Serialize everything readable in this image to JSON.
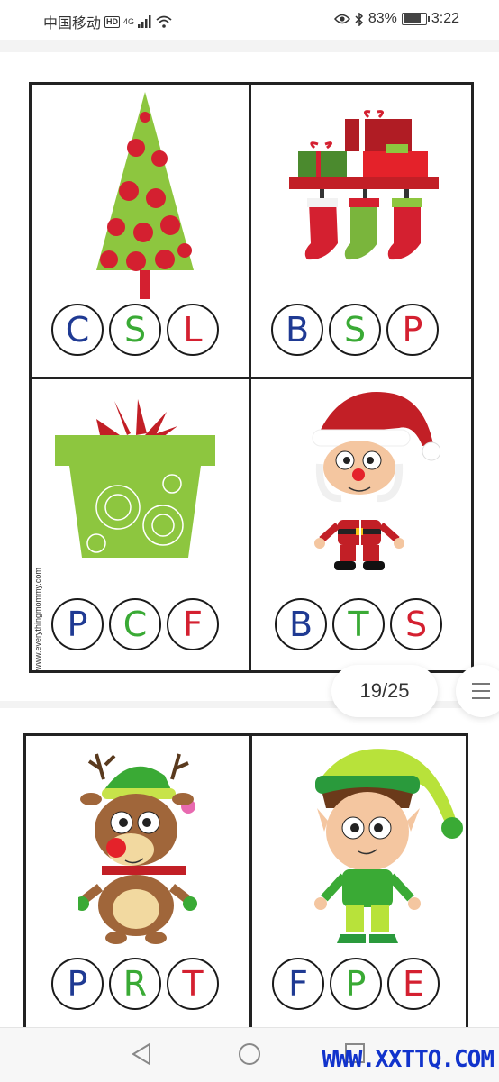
{
  "status_bar": {
    "carrier": "中国移动",
    "hd_badge": "HD",
    "network": "4G",
    "battery_percent": "83%",
    "battery_level": 0.83,
    "time": "3:22"
  },
  "pages": [
    {
      "cards": [
        {
          "picture": "christmas-tree-icon",
          "letters": [
            {
              "char": "C",
              "color": "#1f3a93"
            },
            {
              "char": "S",
              "color": "#3aaa35"
            },
            {
              "char": "L",
              "color": "#d42030"
            }
          ]
        },
        {
          "picture": "stockings-and-gifts-icon",
          "letters": [
            {
              "char": "B",
              "color": "#1f3a93"
            },
            {
              "char": "S",
              "color": "#3aaa35"
            },
            {
              "char": "P",
              "color": "#d42030"
            }
          ]
        },
        {
          "picture": "gift-box-icon",
          "letters": [
            {
              "char": "P",
              "color": "#1f3a93"
            },
            {
              "char": "C",
              "color": "#3aaa35"
            },
            {
              "char": "F",
              "color": "#d42030"
            }
          ]
        },
        {
          "picture": "santa-claus-icon",
          "letters": [
            {
              "char": "B",
              "color": "#1f3a93"
            },
            {
              "char": "T",
              "color": "#3aaa35"
            },
            {
              "char": "S",
              "color": "#d42030"
            }
          ]
        }
      ],
      "side_credit": "www.everythingmommy.com"
    },
    {
      "cards": [
        {
          "picture": "reindeer-icon",
          "letters": [
            {
              "char": "P",
              "color": "#1f3a93"
            },
            {
              "char": "R",
              "color": "#3aaa35"
            },
            {
              "char": "T",
              "color": "#d42030"
            }
          ]
        },
        {
          "picture": "elf-icon",
          "letters": [
            {
              "char": "F",
              "color": "#1f3a93"
            },
            {
              "char": "P",
              "color": "#3aaa35"
            },
            {
              "char": "E",
              "color": "#d42030"
            }
          ]
        }
      ]
    }
  ],
  "page_indicator": "19/25",
  "watermark": "WWW.XXTTQ.COM"
}
